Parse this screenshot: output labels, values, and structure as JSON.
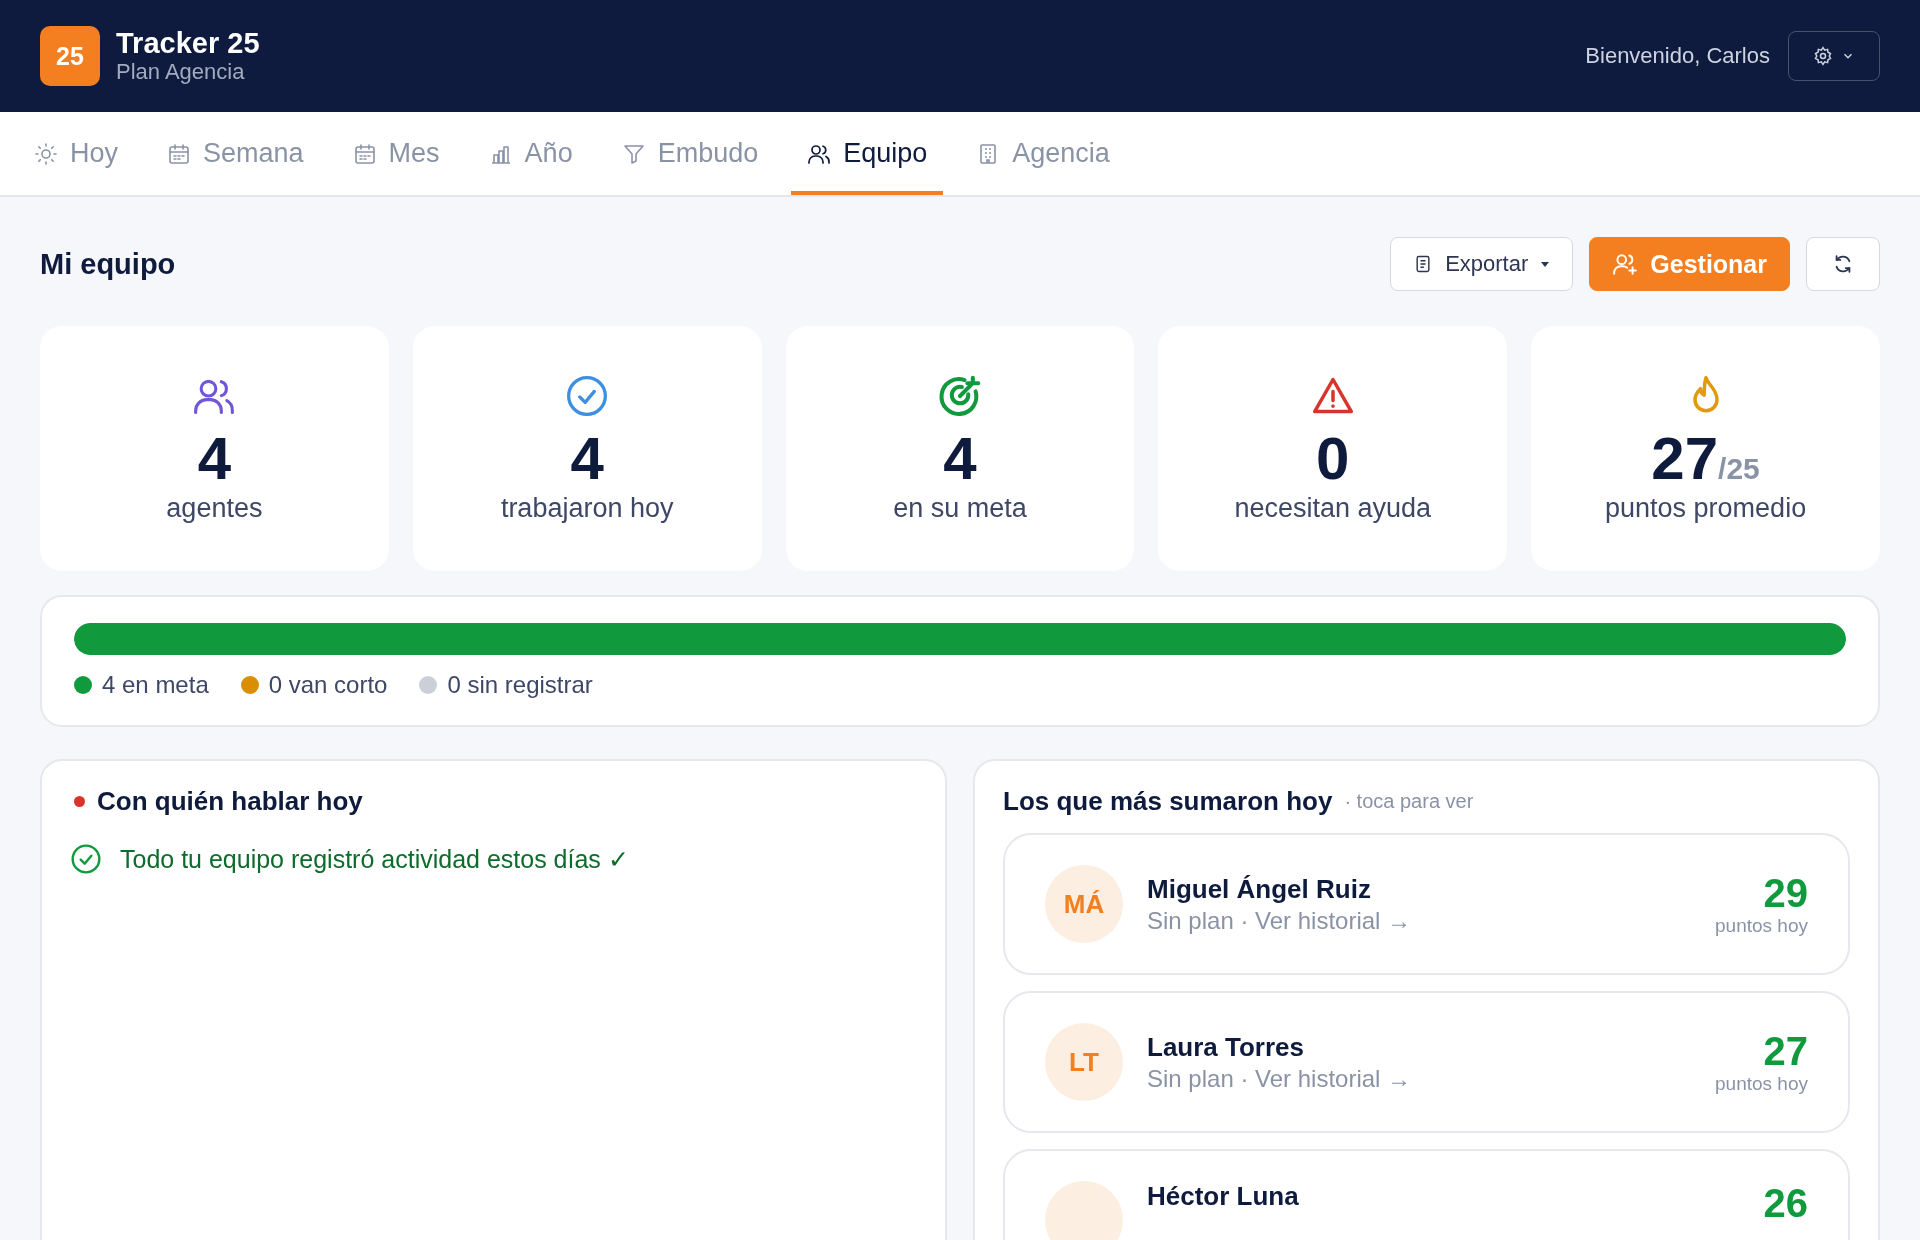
{
  "header": {
    "logo": "25",
    "title": "Tracker 25",
    "plan": "Plan Agencia",
    "welcome": "Bienvenido, Carlos"
  },
  "tabs": [
    {
      "label": "Hoy",
      "selected": false
    },
    {
      "label": "Semana",
      "selected": false
    },
    {
      "label": "Mes",
      "selected": false
    },
    {
      "label": "Año",
      "selected": false
    },
    {
      "label": "Embudo",
      "selected": false
    },
    {
      "label": "Equipo",
      "selected": true
    },
    {
      "label": "Agencia",
      "selected": false
    }
  ],
  "page_title": "Mi equipo",
  "actions": {
    "export": "Exportar",
    "manage": "Gestionar"
  },
  "stats": [
    {
      "value": "4",
      "label": "agentes"
    },
    {
      "value": "4",
      "label": "trabajaron hoy"
    },
    {
      "value": "4",
      "label": "en su meta"
    },
    {
      "value": "0",
      "label": "necesitan ayuda"
    },
    {
      "value": "27",
      "suffix": "/25",
      "label": "puntos promedio"
    }
  ],
  "progress": {
    "level": 1,
    "legend": [
      {
        "label": "4 en meta",
        "color": "#109a3d"
      },
      {
        "label": "0 van corto",
        "color": "#d98e04"
      },
      {
        "label": "0 sin registrar",
        "color": "#cbd0d8"
      }
    ]
  },
  "talk": {
    "title": "Con quién hablar hoy",
    "message": "Todo tu equipo registró actividad estos días ✓"
  },
  "leaders": {
    "title": "Los que más sumaron hoy",
    "hint": "· toca para ver",
    "rows": [
      {
        "initials": "MÁ",
        "name": "Miguel Ángel Ruiz",
        "detail": "Sin plan · Ver historial →",
        "points": "29",
        "points_label": "puntos hoy"
      },
      {
        "initials": "LT",
        "name": "Laura Torres",
        "detail": "Sin plan · Ver historial →",
        "points": "27",
        "points_label": "puntos hoy"
      },
      {
        "name": "Héctor Luna",
        "points": "26"
      }
    ]
  }
}
